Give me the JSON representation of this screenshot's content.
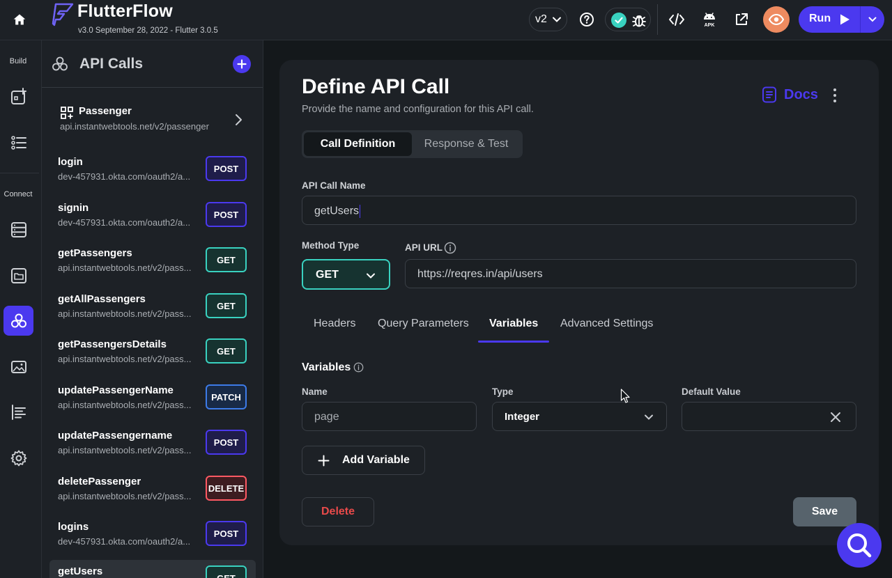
{
  "header": {
    "app_name": "FlutterFlow",
    "version_info": "v3.0 September 28, 2022 - Flutter 3.0.5",
    "branch_label": "v2",
    "run_label": "Run",
    "icons": [
      "home-icon",
      "help-icon",
      "check-icon",
      "bug-icon",
      "code-icon",
      "android-apk-icon",
      "open-external-icon",
      "eye-icon",
      "play-icon",
      "chevron-down-icon"
    ]
  },
  "rail": {
    "build_label": "Build",
    "connect_label": "Connect",
    "icons": [
      "add-widget-icon",
      "list-icon",
      "database-icon",
      "folder-icon",
      "api-icon",
      "media-icon",
      "custom-code-icon",
      "settings-icon"
    ]
  },
  "sidebar": {
    "title": "API Calls",
    "group": {
      "name": "Passenger",
      "url": "api.instantwebtools.net/v2/passenger"
    },
    "items": [
      {
        "name": "login",
        "url": "dev-457931.okta.com/oauth2/a...",
        "method": "POST"
      },
      {
        "name": "signin",
        "url": "dev-457931.okta.com/oauth2/a...",
        "method": "POST"
      },
      {
        "name": "getPassengers",
        "url": "api.instantwebtools.net/v2/pass...",
        "method": "GET"
      },
      {
        "name": "getAllPassengers",
        "url": "api.instantwebtools.net/v2/pass...",
        "method": "GET"
      },
      {
        "name": "getPassengersDetails",
        "url": "api.instantwebtools.net/v2/pass...",
        "method": "GET"
      },
      {
        "name": "updatePassengerName",
        "url": "api.instantwebtools.net/v2/pass...",
        "method": "PATCH"
      },
      {
        "name": "updatePassengername",
        "url": "api.instantwebtools.net/v2/pass...",
        "method": "POST"
      },
      {
        "name": "deletePassenger",
        "url": "api.instantwebtools.net/v2/pass...",
        "method": "DELETE"
      },
      {
        "name": "logins",
        "url": "dev-457931.okta.com/oauth2/a...",
        "method": "POST"
      },
      {
        "name": "getUsers",
        "url": "",
        "method": "GET"
      }
    ]
  },
  "main": {
    "title": "Define API Call",
    "subtitle": "Provide the name and configuration for this API call.",
    "docs_label": "Docs",
    "tabs_top": {
      "active": "Call Definition",
      "other": "Response & Test"
    },
    "api_call_name_label": "API Call Name",
    "api_call_name_value": "getUsers",
    "method_type_label": "Method Type",
    "method_type_value": "GET",
    "api_url_label": "API URL",
    "api_url_value": "https://reqres.in/api/users",
    "tabs": [
      "Headers",
      "Query Parameters",
      "Variables",
      "Advanced Settings"
    ],
    "active_tab": "Variables",
    "variables_label": "Variables",
    "columns": {
      "name": "Name",
      "type": "Type",
      "default": "Default Value"
    },
    "variable": {
      "name": "page",
      "type": "Integer",
      "default": ""
    },
    "add_variable_label": "Add Variable",
    "delete_label": "Delete",
    "save_label": "Save"
  },
  "colors": {
    "accent": "#4b39ef",
    "teal": "#39d2c0",
    "danger": "#e84a4a",
    "orange": "#ee8b60"
  }
}
